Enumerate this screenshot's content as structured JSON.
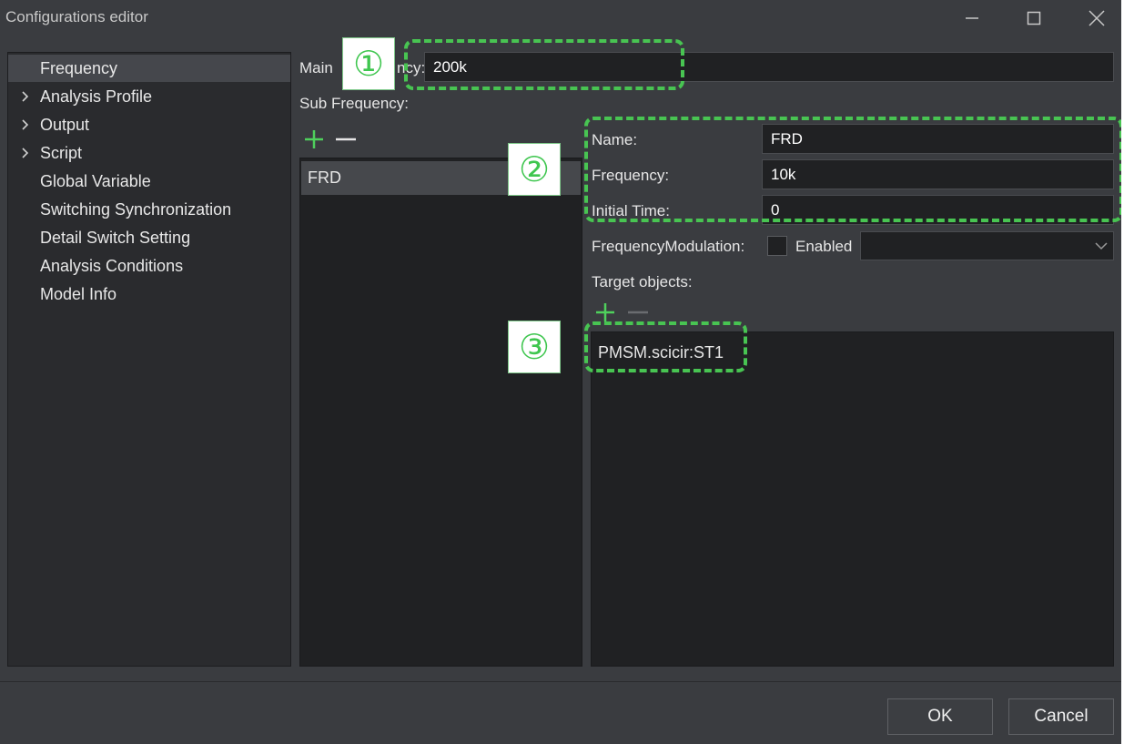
{
  "window": {
    "title": "Configurations editor",
    "minimize_icon": "minimize-icon",
    "maximize_icon": "maximize-icon",
    "close_icon": "close-icon"
  },
  "tree": {
    "items": [
      {
        "label": "Frequency",
        "expandable": false,
        "selected": true
      },
      {
        "label": "Analysis Profile",
        "expandable": true
      },
      {
        "label": "Output",
        "expandable": true
      },
      {
        "label": "Script",
        "expandable": true
      },
      {
        "label": "Global Variable",
        "expandable": false
      },
      {
        "label": "Switching Synchronization",
        "expandable": false
      },
      {
        "label": "Detail Switch Setting",
        "expandable": false
      },
      {
        "label": "Analysis Conditions",
        "expandable": false
      },
      {
        "label": "Model Info",
        "expandable": false
      }
    ]
  },
  "main": {
    "main_label_left": "Main",
    "main_label_right": "ncy:",
    "main_frequency_value": "200k",
    "sub_frequency_label": "Sub Frequency:",
    "sub_items": [
      "FRD"
    ]
  },
  "details": {
    "name_label": "Name:",
    "name_value": "FRD",
    "frequency_label": "Frequency:",
    "frequency_value": "10k",
    "initial_time_label": "Initial Time:",
    "initial_time_value": "0",
    "modulation_label": "FrequencyModulation:",
    "enabled_label": "Enabled",
    "target_objects_label": "Target objects:",
    "targets": [
      "PMSM.scicir:ST1"
    ]
  },
  "markers": [
    "①",
    "②",
    "③"
  ],
  "footer": {
    "ok_label": "OK",
    "cancel_label": "Cancel"
  },
  "colors": {
    "accent_green": "#48c452",
    "background": "#3a3c40",
    "panel": "#2a2b2e",
    "input": "#202123"
  }
}
